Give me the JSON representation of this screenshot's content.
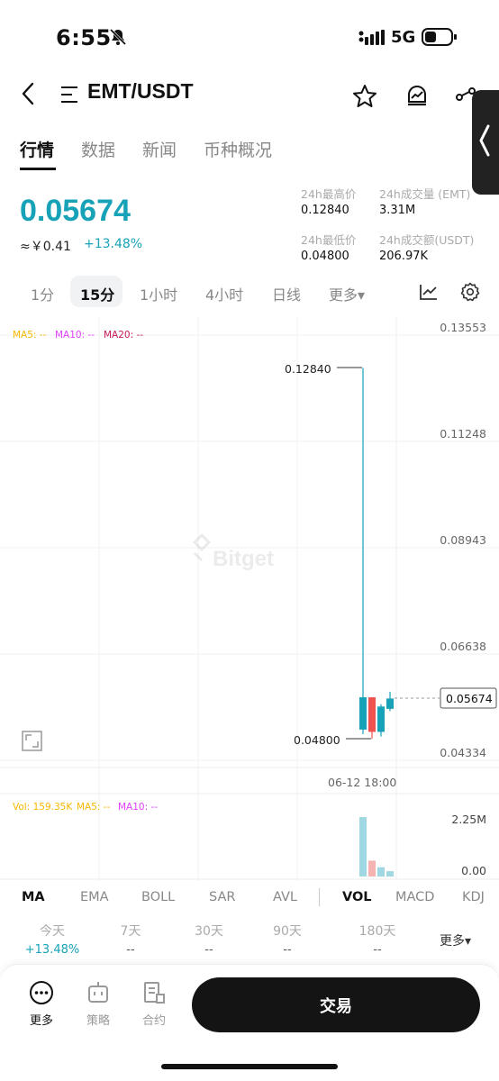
{
  "status_bar": {
    "time": "6:55",
    "network": "5G"
  },
  "header": {
    "pair": "EMT/USDT"
  },
  "tabs": [
    {
      "label": "行情",
      "active": true
    },
    {
      "label": "数据",
      "active": false
    },
    {
      "label": "新闻",
      "active": false
    },
    {
      "label": "币种概况",
      "active": false
    }
  ],
  "price": {
    "last": "0.05674",
    "cny": "≈￥0.41",
    "change": "+13.48%"
  },
  "stats": {
    "high_label": "24h最高价",
    "high_value": "0.12840",
    "vol_label": "24h成交量 (EMT)",
    "vol_value": "3.31M",
    "low_label": "24h最低价",
    "low_value": "0.04800",
    "turnover_label": "24h成交额(USDT)",
    "turnover_value": "206.97K"
  },
  "intervals": [
    {
      "label": "1分",
      "active": false
    },
    {
      "label": "15分",
      "active": true
    },
    {
      "label": "1小时",
      "active": false
    },
    {
      "label": "4小时",
      "active": false
    },
    {
      "label": "日线",
      "active": false
    },
    {
      "label": "更多▾",
      "active": false
    }
  ],
  "chart_labels": {
    "ma5": "MA5: --",
    "ma10": "MA10: --",
    "ma20": "MA20: --",
    "watermark": "Bitget",
    "high_marker": "0.12840",
    "low_marker": "0.04800",
    "current_price_tag": "0.05674",
    "time_label": "06-12 18:00",
    "vol": "Vol: 159.35K",
    "vol_ma5": "MA5: --",
    "vol_ma10": "MA10: --"
  },
  "colors": {
    "up": "#17a2b8",
    "down": "#ef5350",
    "ma5": "#f5b800",
    "ma10": "#e040fb",
    "ma20": "#c2185b"
  },
  "chart_data": {
    "type": "candlestick",
    "y_axis_ticks": [
      "0.13553",
      "0.11248",
      "0.08943",
      "0.06638",
      "0.04334"
    ],
    "ylim": [
      0.04334,
      0.13553
    ],
    "candles": [
      {
        "open": 0.05,
        "high": 0.1284,
        "low": 0.049,
        "close": 0.057,
        "direction": "up"
      },
      {
        "open": 0.057,
        "high": 0.057,
        "low": 0.048,
        "close": 0.0495,
        "direction": "down"
      },
      {
        "open": 0.0495,
        "high": 0.0555,
        "low": 0.0485,
        "close": 0.055,
        "direction": "up"
      },
      {
        "open": 0.0545,
        "high": 0.0582,
        "low": 0.054,
        "close": 0.05674,
        "direction": "up"
      }
    ],
    "volume_axis_ticks": [
      "2.25M",
      "0.00"
    ],
    "volume_ylim": [
      0,
      2.25
    ],
    "volumes_m": [
      2.3,
      0.6,
      0.35,
      0.2
    ],
    "volume_direction": [
      "up",
      "down",
      "up",
      "up"
    ]
  },
  "indicators": [
    {
      "label": "MA",
      "active": true
    },
    {
      "label": "EMA",
      "active": false
    },
    {
      "label": "BOLL",
      "active": false
    },
    {
      "label": "SAR",
      "active": false
    },
    {
      "label": "AVL",
      "active": false
    },
    {
      "label": "VOL",
      "active": true
    },
    {
      "label": "MACD",
      "active": false
    },
    {
      "label": "KDJ",
      "active": false
    }
  ],
  "periods": [
    {
      "label": "今天",
      "value": "+13.48%"
    },
    {
      "label": "7天",
      "value": "--"
    },
    {
      "label": "30天",
      "value": "--"
    },
    {
      "label": "90天",
      "value": "--"
    },
    {
      "label": "180天",
      "value": "--"
    }
  ],
  "more_periods": "更多▾",
  "bottom_nav": {
    "more": "更多",
    "strategy": "策略",
    "contract": "合约",
    "trade": "交易"
  }
}
